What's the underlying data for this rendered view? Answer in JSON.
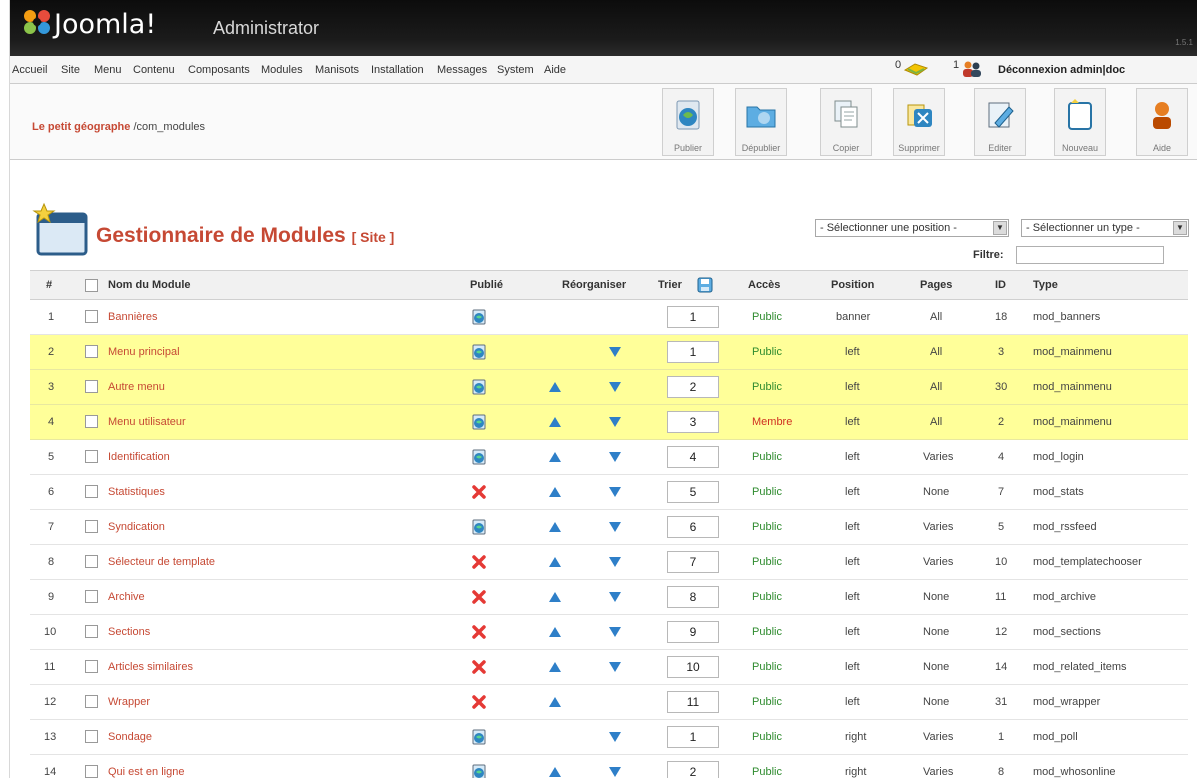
{
  "app": {
    "brand": "Joomla!",
    "subtitle": "Administrator",
    "version": "1.5.1"
  },
  "menubar": {
    "items": [
      "Accueil",
      "Site",
      "Menu",
      "Contenu",
      "Composants",
      "Modules",
      "Manisots",
      "Installation",
      "Messages",
      "System",
      "Aide"
    ],
    "messages_count": "0",
    "users_count": "1",
    "logout": "Déconnexion admin|doc"
  },
  "toolbar": {
    "site_name": "Le petit géographe",
    "path": "/com_modules",
    "buttons": [
      {
        "label": "Publier",
        "icon": "publish-icon"
      },
      {
        "label": "Dépublier",
        "icon": "unpublish-icon"
      },
      {
        "label": "Copier",
        "icon": "copy-icon"
      },
      {
        "label": "Supprimer",
        "icon": "delete-icon"
      },
      {
        "label": "Editer",
        "icon": "edit-icon"
      },
      {
        "label": "Nouveau",
        "icon": "new-icon"
      },
      {
        "label": "Aide",
        "icon": "help-icon"
      }
    ]
  },
  "panel": {
    "title": "Gestionnaire de Modules",
    "suffix": "[ Site ]",
    "position_select": "- Sélectionner une position -",
    "type_select": "- Sélectionner un type -",
    "filter_label": "Filtre:",
    "filter_value": ""
  },
  "table": {
    "headers": {
      "num": "#",
      "name": "Nom du Module",
      "published": "Publié",
      "reorder": "Réorganiser",
      "sort": "Trier",
      "access": "Accès",
      "position": "Position",
      "pages": "Pages",
      "id": "ID",
      "type": "Type"
    },
    "rows": [
      {
        "num": "1",
        "name": "Bannières",
        "published": true,
        "up": false,
        "down": false,
        "order": "1",
        "access": "Public",
        "position": "banner",
        "pages": "All",
        "id": "18",
        "type": "mod_banners",
        "highlight": false
      },
      {
        "num": "2",
        "name": "Menu principal",
        "published": true,
        "up": false,
        "down": true,
        "order": "1",
        "access": "Public",
        "position": "left",
        "pages": "All",
        "id": "3",
        "type": "mod_mainmenu",
        "highlight": true
      },
      {
        "num": "3",
        "name": "Autre menu",
        "published": true,
        "up": true,
        "down": true,
        "order": "2",
        "access": "Public",
        "position": "left",
        "pages": "All",
        "id": "30",
        "type": "mod_mainmenu",
        "highlight": true
      },
      {
        "num": "4",
        "name": "Menu utilisateur",
        "published": true,
        "up": true,
        "down": true,
        "order": "3",
        "access": "Membre",
        "position": "left",
        "pages": "All",
        "id": "2",
        "type": "mod_mainmenu",
        "highlight": true
      },
      {
        "num": "5",
        "name": "Identification",
        "published": true,
        "up": true,
        "down": true,
        "order": "4",
        "access": "Public",
        "position": "left",
        "pages": "Varies",
        "id": "4",
        "type": "mod_login",
        "highlight": false
      },
      {
        "num": "6",
        "name": "Statistiques",
        "published": false,
        "up": true,
        "down": true,
        "order": "5",
        "access": "Public",
        "position": "left",
        "pages": "None",
        "id": "7",
        "type": "mod_stats",
        "highlight": false
      },
      {
        "num": "7",
        "name": "Syndication",
        "published": true,
        "up": true,
        "down": true,
        "order": "6",
        "access": "Public",
        "position": "left",
        "pages": "Varies",
        "id": "5",
        "type": "mod_rssfeed",
        "highlight": false
      },
      {
        "num": "8",
        "name": "Sélecteur de template",
        "published": false,
        "up": true,
        "down": true,
        "order": "7",
        "access": "Public",
        "position": "left",
        "pages": "Varies",
        "id": "10",
        "type": "mod_templatechooser",
        "highlight": false
      },
      {
        "num": "9",
        "name": "Archive",
        "published": false,
        "up": true,
        "down": true,
        "order": "8",
        "access": "Public",
        "position": "left",
        "pages": "None",
        "id": "11",
        "type": "mod_archive",
        "highlight": false
      },
      {
        "num": "10",
        "name": "Sections",
        "published": false,
        "up": true,
        "down": true,
        "order": "9",
        "access": "Public",
        "position": "left",
        "pages": "None",
        "id": "12",
        "type": "mod_sections",
        "highlight": false
      },
      {
        "num": "11",
        "name": "Articles similaires",
        "published": false,
        "up": true,
        "down": true,
        "order": "10",
        "access": "Public",
        "position": "left",
        "pages": "None",
        "id": "14",
        "type": "mod_related_items",
        "highlight": false
      },
      {
        "num": "12",
        "name": "Wrapper",
        "published": false,
        "up": true,
        "down": false,
        "order": "11",
        "access": "Public",
        "position": "left",
        "pages": "None",
        "id": "31",
        "type": "mod_wrapper",
        "highlight": false
      },
      {
        "num": "13",
        "name": "Sondage",
        "published": true,
        "up": false,
        "down": true,
        "order": "1",
        "access": "Public",
        "position": "right",
        "pages": "Varies",
        "id": "1",
        "type": "mod_poll",
        "highlight": false
      },
      {
        "num": "14",
        "name": "Qui est en ligne",
        "published": true,
        "up": true,
        "down": true,
        "order": "2",
        "access": "Public",
        "position": "right",
        "pages": "Varies",
        "id": "8",
        "type": "mod_whosonline",
        "highlight": false
      }
    ]
  },
  "colors": {
    "header_bg": "#111111",
    "title_red": "#c64934",
    "highlight_yellow": "#ffff99",
    "access_public": "#2e8b2e",
    "access_member": "#d03020",
    "arrow_blue": "#2e7fc8"
  }
}
